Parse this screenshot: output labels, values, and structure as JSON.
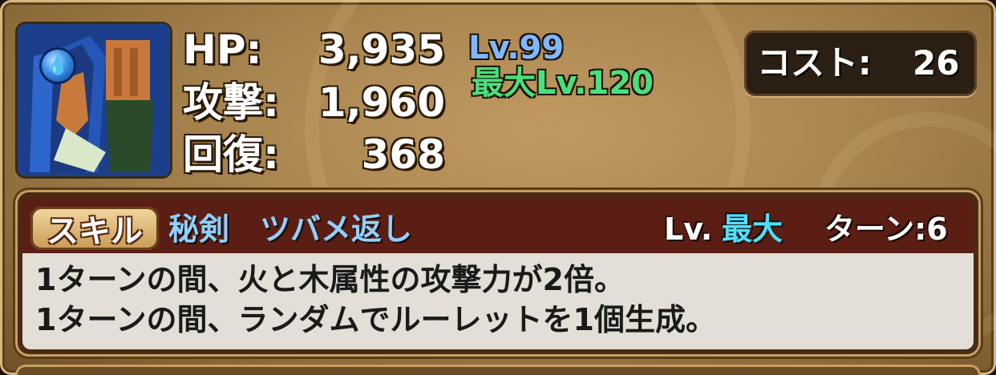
{
  "monster": {
    "attribute_icon": "water-drop-icon",
    "portrait_icon": "blue-haired-swordsman-portrait"
  },
  "stats": {
    "hp_label": "HP:",
    "hp_value": "3,935",
    "atk_label": "攻撃:",
    "atk_value": "1,960",
    "rcv_label": "回復:",
    "rcv_value": "368"
  },
  "level": {
    "current": "Lv.99",
    "max": "最大Lv.120"
  },
  "cost": {
    "label": "コスト:",
    "value": "26"
  },
  "skill": {
    "badge": "スキル",
    "name": "秘剣　ツバメ返し",
    "lv_prefix": "Lv.",
    "lv_value": "最大",
    "turn": "ターン:6",
    "description": [
      "1ターンの間、火と木属性の攻撃力が2倍。",
      "1ターンの間、ランダムでルーレットを1個生成。"
    ]
  },
  "colors": {
    "level_current": "#7fb8ff",
    "level_max": "#48e07a",
    "skill_name": "#8fd0ff",
    "skill_lv_value": "#4ee0ff"
  }
}
